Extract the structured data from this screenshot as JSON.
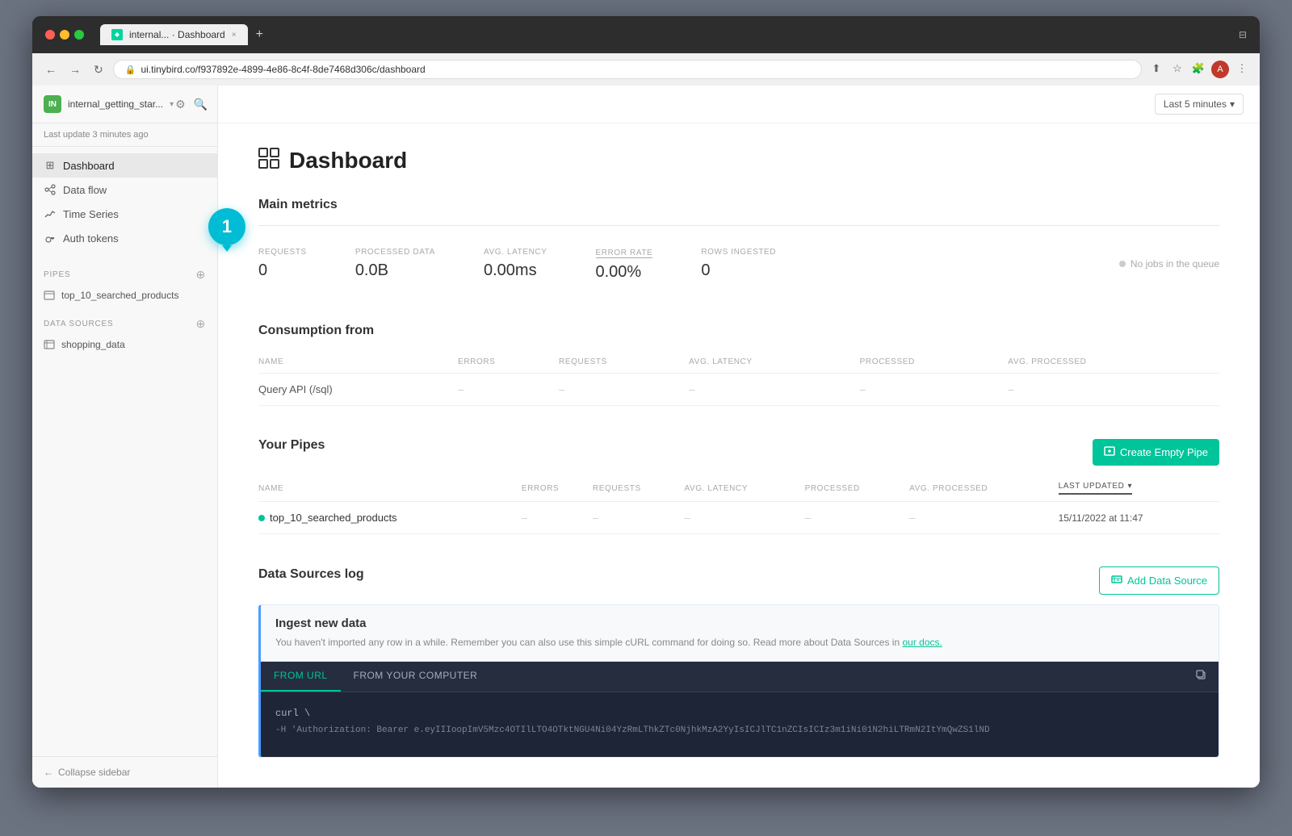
{
  "browser": {
    "url": "ui.tinybird.co/f937892e-4899-4e86-8c4f-8de7468d306c/dashboard",
    "tab_title": "internal... · Dashboard",
    "tab_close": "×",
    "new_tab": "+"
  },
  "sidebar": {
    "workspace_badge": "IN",
    "workspace_name": "internal_getting_star...",
    "last_update": "Last update 3 minutes ago",
    "nav_items": [
      {
        "label": "Dashboard",
        "active": true
      },
      {
        "label": "Data flow",
        "active": false
      },
      {
        "label": "Time Series",
        "active": false
      },
      {
        "label": "Auth tokens",
        "active": false
      }
    ],
    "pipes_label": "PIPES",
    "pipes": [
      {
        "label": "top_10_searched_products"
      }
    ],
    "data_sources_label": "DATA SOURCES",
    "data_sources": [
      {
        "label": "shopping_data"
      }
    ],
    "collapse_label": "Collapse sidebar"
  },
  "topbar": {
    "time_range": "Last 5 minutes",
    "chevron": "▾"
  },
  "main": {
    "page_title": "Dashboard",
    "sections": {
      "main_metrics": {
        "title": "Main metrics",
        "metrics": [
          {
            "label": "REQUESTS",
            "value": "0"
          },
          {
            "label": "PROCESSED DATA",
            "value": "0.0B"
          },
          {
            "label": "AVG. LATENCY",
            "value": "0.00ms"
          },
          {
            "label": "ERROR RATE",
            "value": "0.00%",
            "underline": true
          },
          {
            "label": "ROWS INGESTED",
            "value": "0"
          }
        ],
        "queue_status": "No jobs in the queue"
      },
      "consumption": {
        "title": "Consumption from",
        "columns": [
          "NAME",
          "ERRORS",
          "REQUESTS",
          "AVG. LATENCY",
          "PROCESSED",
          "AVG. PROCESSED"
        ],
        "rows": [
          {
            "name": "Query API (/sql)",
            "errors": "–",
            "requests": "–",
            "avg_latency": "–",
            "processed": "–",
            "avg_processed": "–"
          }
        ]
      },
      "your_pipes": {
        "title": "Your Pipes",
        "create_btn": "Create Empty Pipe",
        "columns": [
          "NAME",
          "ERRORS",
          "REQUESTS",
          "AVG. LATENCY",
          "PROCESSED",
          "AVG. PROCESSED",
          "LAST UPDATED"
        ],
        "rows": [
          {
            "name": "top_10_searched_products",
            "errors": "–",
            "requests": "–",
            "avg_latency": "–",
            "processed": "–",
            "avg_processed": "–",
            "last_updated": "15/11/2022 at 11:47"
          }
        ]
      },
      "data_sources": {
        "title": "Data Sources log",
        "add_btn": "Add Data Source",
        "ingest": {
          "title": "Ingest new data",
          "description": "You haven't imported any row in a while. Remember you can also use this simple cURL command for doing so. Read more about Data Sources in",
          "link_text": "our docs.",
          "tabs": [
            "FROM URL",
            "FROM YOUR COMPUTER"
          ],
          "active_tab": 0,
          "code_lines": [
            "curl \\",
            "-H 'Authorization: Bearer e.eyIIIoopImV5Mzc4OTIlLTO4OTktNGU4Ni04YzRmLThkZTc0NjhkMzA2YyIsICJlTC1nZCIsICIz3m1iNi01N2hiLTRmN2ItYmQwZS1lND"
          ]
        }
      }
    }
  },
  "tooltip": {
    "number": "1"
  },
  "icons": {
    "dashboard": "⊞",
    "data_flow": "⟳",
    "time_series": "📈",
    "auth_tokens": "🔒",
    "pipe": "▣",
    "datasource": "▣",
    "pipe_icon": "≡",
    "copy_icon": "⧉"
  }
}
